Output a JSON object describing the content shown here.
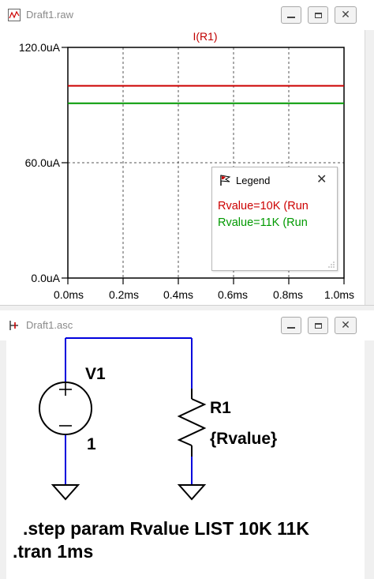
{
  "waveform_window": {
    "title": "Draft1.raw",
    "trace_name": "I(R1)",
    "y_ticks": [
      "120.0uA",
      "60.0uA",
      "0.0uA"
    ],
    "x_ticks": [
      "0.0ms",
      "0.2ms",
      "0.4ms",
      "0.6ms",
      "0.8ms",
      "1.0ms"
    ],
    "legend": {
      "title": "Legend",
      "entries": [
        {
          "label": "Rvalue=10K  (Run",
          "color": "#cc0000"
        },
        {
          "label": "Rvalue=11K  (Run",
          "color": "#009900"
        }
      ]
    }
  },
  "chart_data": {
    "type": "line",
    "title": "I(R1)",
    "xlabel": "",
    "ylabel": "",
    "x_unit": "ms",
    "y_unit": "uA",
    "xlim": [
      0,
      1.0
    ],
    "ylim": [
      0,
      120
    ],
    "grid": true,
    "legend_position": "bottom-right",
    "series": [
      {
        "name": "Rvalue=10K  (Run",
        "color": "#cc0000",
        "x": [
          0,
          1.0
        ],
        "y": [
          100,
          100
        ]
      },
      {
        "name": "Rvalue=11K  (Run",
        "color": "#009900",
        "x": [
          0,
          1.0
        ],
        "y": [
          90.9,
          90.9
        ]
      }
    ]
  },
  "schematic_window": {
    "title": "Draft1.asc",
    "source_name": "V1",
    "source_value": "1",
    "resistor_name": "R1",
    "resistor_value": "{Rvalue}",
    "directives": [
      ".step param Rvalue LIST 10K 11K",
      ".tran 1ms"
    ]
  }
}
